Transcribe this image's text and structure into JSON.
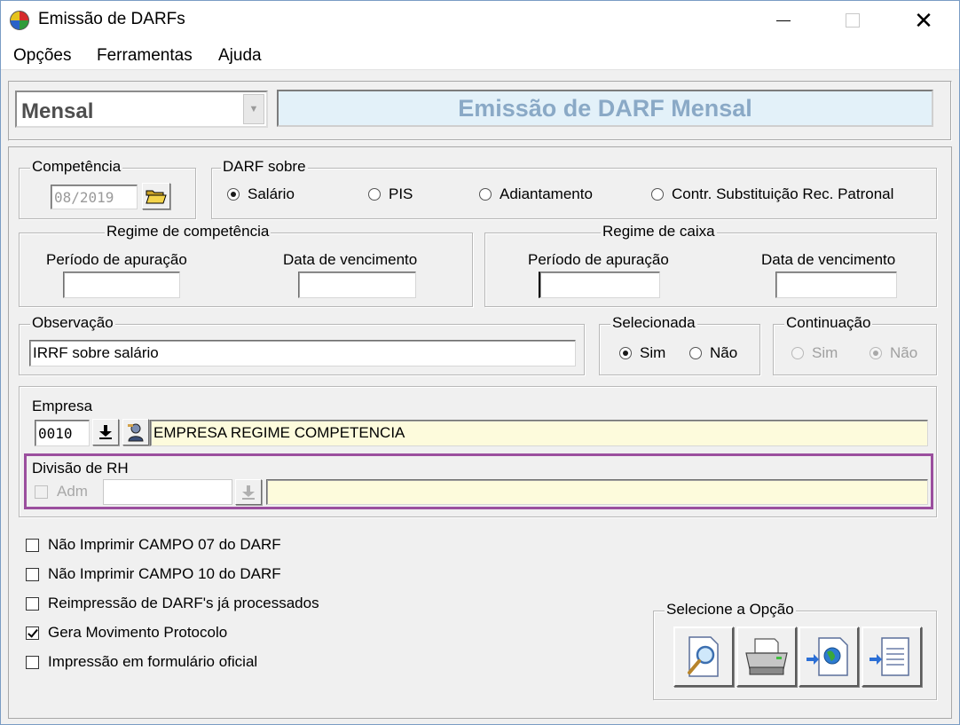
{
  "window": {
    "title": "Emissão de DARFs"
  },
  "menu": {
    "items": [
      "Opções",
      "Ferramentas",
      "Ajuda"
    ]
  },
  "header": {
    "type_value": "Mensal",
    "banner": "Emissão de DARF Mensal"
  },
  "competencia": {
    "label": "Competência",
    "value": "08/2019"
  },
  "darf_sobre": {
    "label": "DARF sobre",
    "options": [
      "Salário",
      "PIS",
      "Adiantamento",
      "Contr. Substituição Rec. Patronal"
    ],
    "selected": "Salário"
  },
  "regime_competencia": {
    "label": "Regime de competência",
    "periodo_label": "Período de apuração",
    "periodo_value": "",
    "vencimento_label": "Data de vencimento",
    "vencimento_value": ""
  },
  "regime_caixa": {
    "label": "Regime de caixa",
    "periodo_label": "Período de apuração",
    "periodo_value": "",
    "vencimento_label": "Data de vencimento",
    "vencimento_value": ""
  },
  "observacao": {
    "label": "Observação",
    "value": "IRRF sobre salário"
  },
  "selecionada": {
    "label": "Selecionada",
    "sim": "Sim",
    "nao": "Não",
    "selected": "Sim"
  },
  "continuacao": {
    "label": "Continuação",
    "sim": "Sim",
    "nao": "Não",
    "selected": "Não",
    "enabled": false
  },
  "empresa": {
    "label": "Empresa",
    "code": "0010",
    "name": "EMPRESA REGIME COMPETENCIA"
  },
  "divisao_rh": {
    "label": "Divisão de RH",
    "adm_label": "Adm",
    "code": "",
    "name": ""
  },
  "options": {
    "items": [
      {
        "label": "Não Imprimir CAMPO 07 do DARF",
        "checked": false
      },
      {
        "label": "Não Imprimir CAMPO 10 do DARF",
        "checked": false
      },
      {
        "label": "Reimpressão de DARF's já processados",
        "checked": false
      },
      {
        "label": "Gera Movimento Protocolo",
        "checked": true
      },
      {
        "label": "Impressão em formulário oficial",
        "checked": false
      }
    ]
  },
  "selecione": {
    "label": "Selecione a Opção",
    "buttons": [
      "preview-icon",
      "printer-icon",
      "export-web-icon",
      "export-file-icon"
    ]
  },
  "colors": {
    "banner_text": "#8aa9c6",
    "highlight": "#9b4f9e",
    "yellow_field": "#fdfbdc"
  }
}
